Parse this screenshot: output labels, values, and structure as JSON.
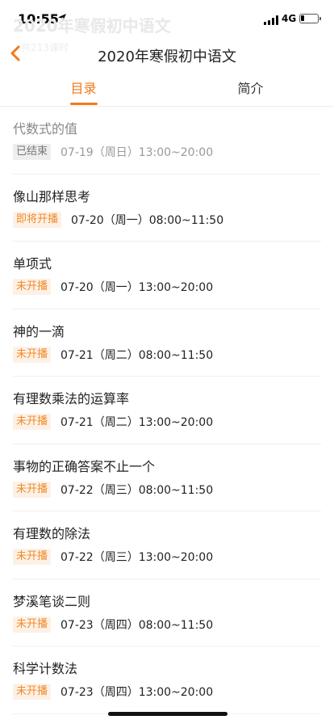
{
  "status": {
    "time": "10:55",
    "network": "4G"
  },
  "ghost": {
    "title": "2020年寒假初中语文",
    "subtitle": "共213课时"
  },
  "nav": {
    "title": "2020年寒假初中语文"
  },
  "tabs": [
    {
      "label": "目录",
      "active": true
    },
    {
      "label": "简介",
      "active": false
    }
  ],
  "lessons": [
    {
      "title": "代数式的值",
      "status": "已结束",
      "time": "07-19（周日）13:00~20:00"
    },
    {
      "title": "像山那样思考",
      "status": "即将开播",
      "time": "07-20（周一）08:00~11:50"
    },
    {
      "title": "单项式",
      "status": "未开播",
      "time": "07-20（周一）13:00~20:00"
    },
    {
      "title": "神的一滴",
      "status": "未开播",
      "time": "07-21（周二）08:00~11:50"
    },
    {
      "title": "有理数乘法的运算率",
      "status": "未开播",
      "time": "07-21（周二）13:00~20:00"
    },
    {
      "title": "事物的正确答案不止一个",
      "status": "未开播",
      "time": "07-22（周三）08:00~11:50"
    },
    {
      "title": "有理数的除法",
      "status": "未开播",
      "time": "07-22（周三）13:00~20:00"
    },
    {
      "title": "梦溪笔谈二则",
      "status": "未开播",
      "time": "07-23（周四）08:00~11:50"
    },
    {
      "title": "科学计数法",
      "status": "未开播",
      "time": "07-23（周四）13:00~20:00"
    }
  ],
  "colors": {
    "accent": "#f07a1b",
    "badge_bg": "#fdf1e6",
    "badge_done_bg": "#eeeeee"
  },
  "icons": {
    "back": "back-chevron-icon",
    "location": "location-arrow-icon",
    "signal": "cellular-signal-icon",
    "battery": "battery-icon"
  }
}
